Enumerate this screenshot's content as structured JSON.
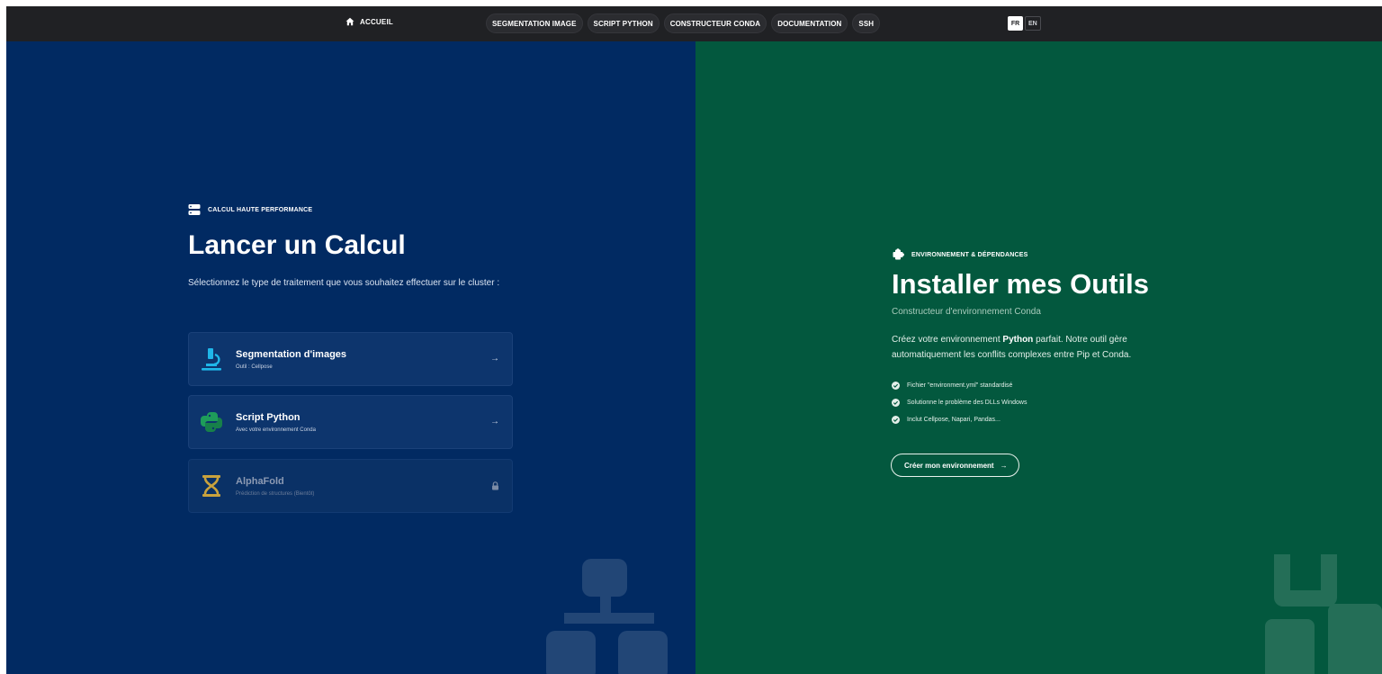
{
  "nav": {
    "home": "ACCUEIL",
    "items": [
      "SEGMENTATION IMAGE",
      "SCRIPT PYTHON",
      "CONSTRUCTEUR CONDA",
      "DOCUMENTATION",
      "SSH"
    ],
    "lang_fr": "FR",
    "lang_en": "EN",
    "active_lang": "FR"
  },
  "left": {
    "eyebrow": "CALCUL HAUTE PERFORMANCE",
    "title": "Lancer un Calcul",
    "description": "Sélectionnez le type de traitement que vous souhaitez effectuer sur le cluster :",
    "cards": [
      {
        "title": "Segmentation d'images",
        "subtitle": "Outil : Cellpose",
        "icon": "microscope-icon"
      },
      {
        "title": "Script Python",
        "subtitle": "Avec votre environnement Conda",
        "icon": "python-icon"
      },
      {
        "title": "AlphaFold",
        "subtitle": "Prédiction de structures (Bientôt)",
        "icon": "dna-icon",
        "locked": true
      }
    ]
  },
  "right": {
    "eyebrow": "ENVIRONNEMENT & DÉPENDANCES",
    "title": "Installer mes Outils",
    "subtitle": "Constructeur d'environnement Conda",
    "desc_before": "Créez votre environnement ",
    "desc_bold": "Python",
    "desc_after": " parfait. Notre outil gère automatiquement les conflits complexes entre Pip et Conda.",
    "checks": [
      "Fichier \"environment.yml\" standardisé",
      "Solutionne le problème des DLLs Windows",
      "Inclut Cellpose, Napari, Pandas..."
    ],
    "cta": "Créer mon environnement"
  },
  "colors": {
    "topbar": "#202124",
    "left_panel": "#012a62",
    "right_panel": "#03583e",
    "microscope": "#1fb6e8",
    "python": "#1e9d5a",
    "alphafold": "#c9a23d"
  }
}
